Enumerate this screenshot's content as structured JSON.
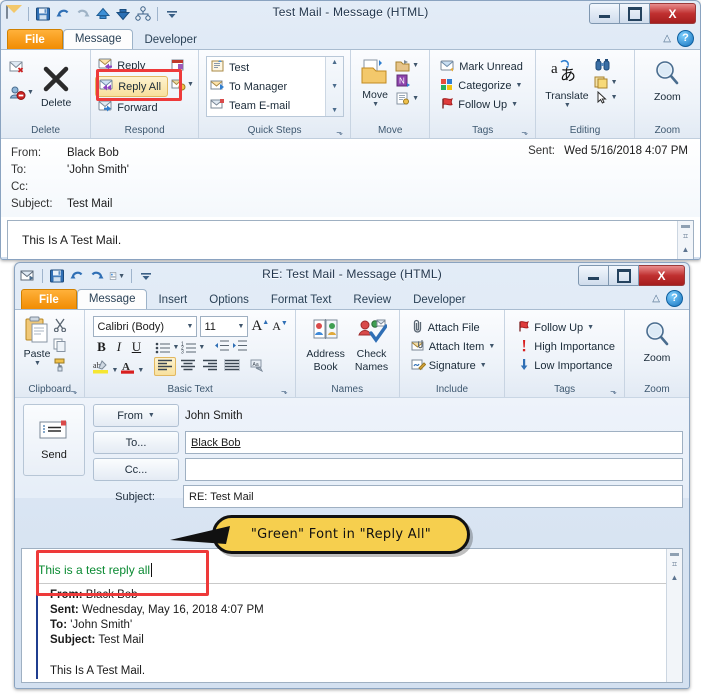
{
  "read_window": {
    "title": "Test Mail  -  Message (HTML)",
    "quick_access": [
      "envelope-icon",
      "save-icon",
      "undo-icon",
      "redo-icon",
      "previous-item-icon",
      "next-item-icon",
      "workflow-icon",
      "customize-qat-icon"
    ],
    "window_buttons": {
      "minimize": "minimize-icon",
      "maximize": "maximize-icon",
      "close": "X"
    },
    "tabs": [
      {
        "label": "File",
        "type": "file"
      },
      {
        "label": "Message",
        "type": "active"
      },
      {
        "label": "Developer",
        "type": "normal"
      }
    ],
    "help": {
      "minimize_ribbon": "△",
      "help": "?"
    },
    "groups": [
      {
        "name": "Delete",
        "label": "Delete",
        "small_left": [
          "ignore-icon",
          "junk-icon"
        ],
        "big": {
          "label": "Delete",
          "icon": "delete-x-icon"
        }
      },
      {
        "name": "Respond",
        "label": "Respond",
        "items": [
          {
            "label": "Reply",
            "icon": "reply-icon"
          },
          {
            "label": "Reply All",
            "icon": "reply-all-icon",
            "highlighted": true
          },
          {
            "label": "Forward",
            "icon": "forward-icon"
          }
        ],
        "extra": [
          "meeting-icon",
          "more-respond-icon",
          "im-icon"
        ]
      },
      {
        "name": "Quick Steps",
        "label": "Quick Steps",
        "items": [
          {
            "label": "Test",
            "icon": "quickstep-test-icon"
          },
          {
            "label": "To Manager",
            "icon": "to-manager-icon"
          },
          {
            "label": "Team E-mail",
            "icon": "team-email-icon"
          }
        ],
        "dialog_launcher": "⬎"
      },
      {
        "name": "Move",
        "label": "Move",
        "big": {
          "label": "Move",
          "icon": "move-icon"
        },
        "items": [
          {
            "label": "",
            "icon": "rules-icon"
          },
          {
            "label": "",
            "icon": "onenote-icon"
          },
          {
            "label": "",
            "icon": "actions-icon"
          }
        ]
      },
      {
        "name": "Tags",
        "label": "Tags",
        "items": [
          {
            "label": "Mark Unread",
            "icon": "mark-unread-icon"
          },
          {
            "label": "Categorize",
            "icon": "categorize-icon"
          },
          {
            "label": "Follow Up",
            "icon": "follow-up-flag-icon"
          }
        ],
        "dialog_launcher": "⬎"
      },
      {
        "name": "Editing",
        "label": "Editing",
        "big": {
          "label": "Translate",
          "icon": "translate-icon"
        },
        "items": [
          {
            "label": "",
            "icon": "find-binoculars-icon"
          },
          {
            "label": "",
            "icon": "related-icon"
          },
          {
            "label": "",
            "icon": "select-pointer-icon"
          }
        ]
      },
      {
        "name": "Zoom",
        "label": "Zoom",
        "big": {
          "label": "Zoom",
          "icon": "zoom-magnifier-icon"
        }
      }
    ],
    "message": {
      "from_label": "From:",
      "from_value": "Black Bob",
      "to_label": "To:",
      "to_value": "'John Smith'",
      "cc_label": "Cc:",
      "cc_value": "",
      "subject_label": "Subject:",
      "subject_value": "Test Mail",
      "sent_label": "Sent:",
      "sent_value": "Wed 5/16/2018 4:07 PM",
      "body": "This Is A Test Mail."
    }
  },
  "compose_window": {
    "title": "RE: Test Mail  -  Message (HTML)",
    "quick_access": [
      "send-envelope-icon",
      "save-icon",
      "undo-icon",
      "redo-icon",
      "options-icon",
      "customize-qat-icon"
    ],
    "window_buttons": {
      "minimize": "minimize-icon",
      "maximize": "maximize-icon",
      "close": "X"
    },
    "tabs": [
      {
        "label": "File",
        "type": "file"
      },
      {
        "label": "Message",
        "type": "active"
      },
      {
        "label": "Insert",
        "type": "normal"
      },
      {
        "label": "Options",
        "type": "normal"
      },
      {
        "label": "Format Text",
        "type": "normal"
      },
      {
        "label": "Review",
        "type": "normal"
      },
      {
        "label": "Developer",
        "type": "normal"
      }
    ],
    "help": {
      "minimize_ribbon": "△",
      "help": "?"
    },
    "groups": {
      "clipboard": {
        "label": "Clipboard",
        "paste_label": "Paste",
        "buttons": [
          "cut-scissors-icon",
          "copy-icon",
          "format-painter-icon"
        ],
        "dialog_launcher": "⬎"
      },
      "basic_text": {
        "label": "Basic Text",
        "font_name": "Calibri (Body)",
        "font_size": "11",
        "grow_font": "A",
        "shrink_font": "A",
        "bold": "B",
        "italic": "I",
        "underline": "U",
        "bullets": "bullet-list-icon",
        "numbering": "numbered-list-icon",
        "decrease_indent": "decrease-indent-icon",
        "increase_indent": "increase-indent-icon",
        "highlight": "text-highlight-icon",
        "font_color": "A",
        "align_left": "align-left-icon",
        "align_center": "align-center-icon",
        "align_right": "align-right-icon",
        "justify": "justify-icon",
        "clear_formatting": "clear-formatting-icon",
        "dialog_launcher": "⬎"
      },
      "names": {
        "label": "Names",
        "items": [
          {
            "label": "Address Book",
            "icon": "address-book-icon"
          },
          {
            "label": "Check Names",
            "icon": "check-names-icon"
          }
        ]
      },
      "include": {
        "label": "Include",
        "items": [
          {
            "label": "Attach File",
            "icon": "paperclip-icon"
          },
          {
            "label": "Attach Item",
            "icon": "attach-item-icon"
          },
          {
            "label": "Signature",
            "icon": "signature-icon"
          }
        ]
      },
      "tags": {
        "label": "Tags",
        "items": [
          {
            "label": "Follow Up",
            "icon": "follow-up-flag-icon"
          },
          {
            "label": "High Importance",
            "icon": "high-importance-icon"
          },
          {
            "label": "Low Importance",
            "icon": "low-importance-icon"
          }
        ],
        "dialog_launcher": "⬎"
      },
      "zoom": {
        "label": "Zoom",
        "button_label": "Zoom",
        "icon": "zoom-magnifier-icon"
      }
    },
    "compose": {
      "send_label": "Send",
      "send_icon": "send-icon",
      "from_label": "From",
      "from_value": "John Smith",
      "to_label": "To...",
      "to_value": "Black Bob",
      "cc_label": "Cc...",
      "cc_value": "",
      "subject_label": "Subject:",
      "subject_value": "RE: Test Mail",
      "reply_text": "This is a test reply all",
      "quoted": {
        "from_label": "From:",
        "from_value": "Black Bob",
        "sent_label": "Sent:",
        "sent_value": "Wednesday, May 16, 2018 4:07 PM",
        "to_label": "To:",
        "to_value": "'John Smith'",
        "subject_label": "Subject:",
        "subject_value": "Test Mail",
        "body": "This Is A Test Mail."
      }
    },
    "callout": {
      "text": "\"Green\" Font in \"Reply All\""
    }
  },
  "colors": {
    "file_tab": "#f08a00",
    "close_button": "#c03030",
    "highlight_box": "#ee3a3a",
    "callout_fill": "#f6cf4e",
    "reply_text_green": "#0a8a32"
  }
}
